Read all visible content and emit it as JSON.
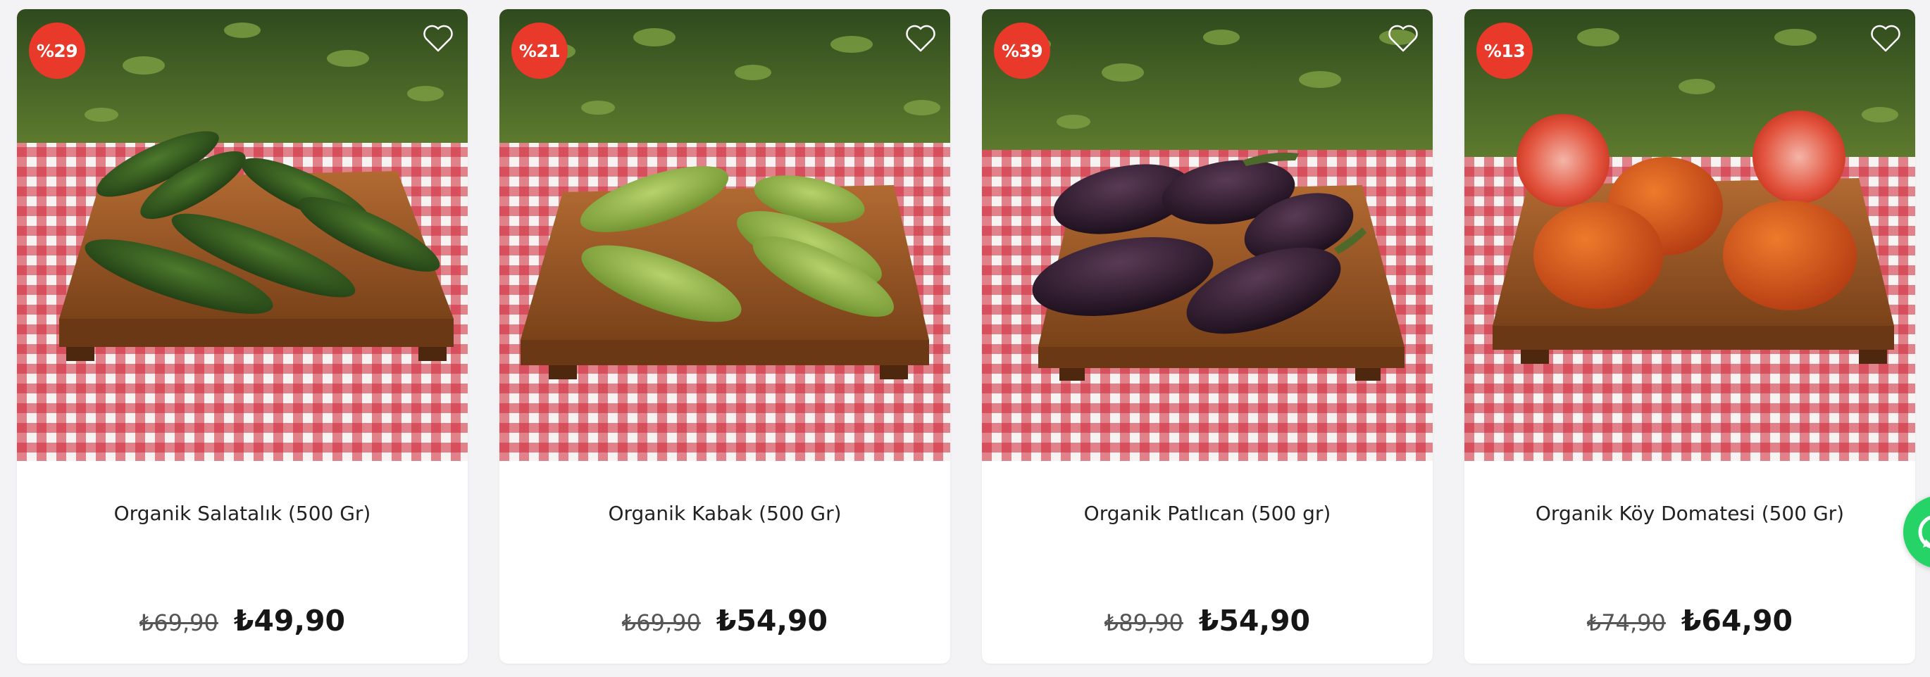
{
  "products": [
    {
      "discount": "%29",
      "title": "Organik Salatalık (500 Gr)",
      "old_price": "₺69,90",
      "price": "₺49,90",
      "image": "cucumbers"
    },
    {
      "discount": "%21",
      "title": "Organik Kabak (500 Gr)",
      "old_price": "₺69,90",
      "price": "₺54,90",
      "image": "zucchini"
    },
    {
      "discount": "%39",
      "title": "Organik Patlıcan (500 gr)",
      "old_price": "₺89,90",
      "price": "₺54,90",
      "image": "eggplants"
    },
    {
      "discount": "%13",
      "title": "Organik Köy Domatesi (500 Gr)",
      "old_price": "₺74,90",
      "price": "₺64,90",
      "image": "tomatoes"
    }
  ],
  "icons": {
    "favorite": "heart-outline-icon",
    "chat": "whatsapp-icon"
  },
  "colors": {
    "badge": "#e8392a",
    "whatsapp": "#25d366",
    "tablecloth": "#cf2436",
    "board": "#9c5a27"
  }
}
